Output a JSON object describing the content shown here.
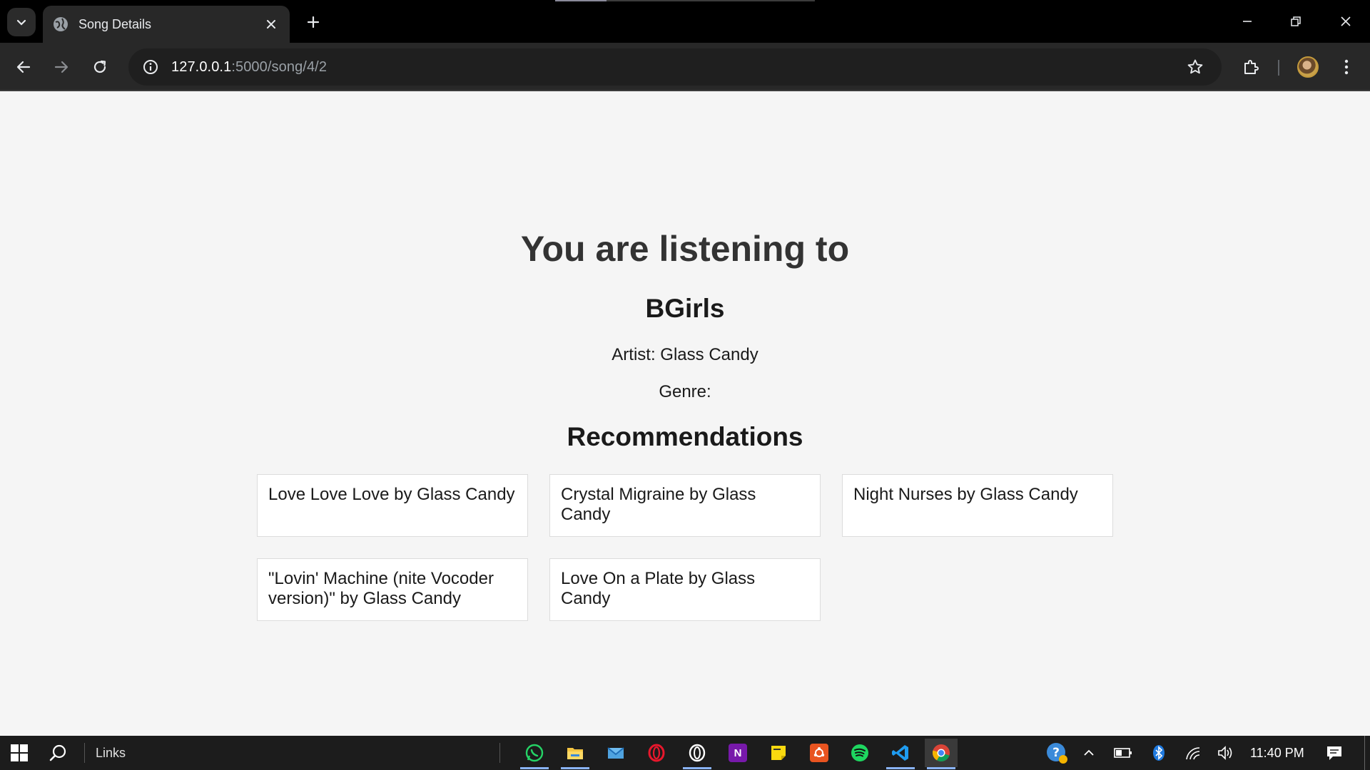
{
  "browser": {
    "tab_title": "Song Details",
    "url_host": "127.0.0.1",
    "url_path": ":5000/song/4/2"
  },
  "page": {
    "heading": "You are listening to",
    "song_title": "BGirls",
    "artist_line": "Artist: Glass Candy",
    "genre_line": "Genre:",
    "recommendations_heading": "Recommendations",
    "recommendations": [
      "Love Love Love by Glass Candy",
      "Crystal Migraine by Glass Candy",
      "Night Nurses by Glass Candy",
      "\"Lovin' Machine (nite Vocoder version)\" by Glass Candy",
      "Love On a Plate by Glass Candy"
    ]
  },
  "taskbar": {
    "links_label": "Links",
    "clock": "11:40 PM",
    "apps": [
      "whatsapp-icon",
      "file-explorer-icon",
      "mail-icon",
      "opera-icon",
      "opera-gx-icon",
      "onenote-icon",
      "sticky-notes-icon",
      "ubuntu-icon",
      "spotify-icon",
      "vscode-icon",
      "chrome-icon"
    ]
  },
  "colors": {
    "page_background": "#f5f5f5",
    "chrome_dark": "#282828",
    "card_background": "#ffffff",
    "heading_text": "#333333"
  }
}
